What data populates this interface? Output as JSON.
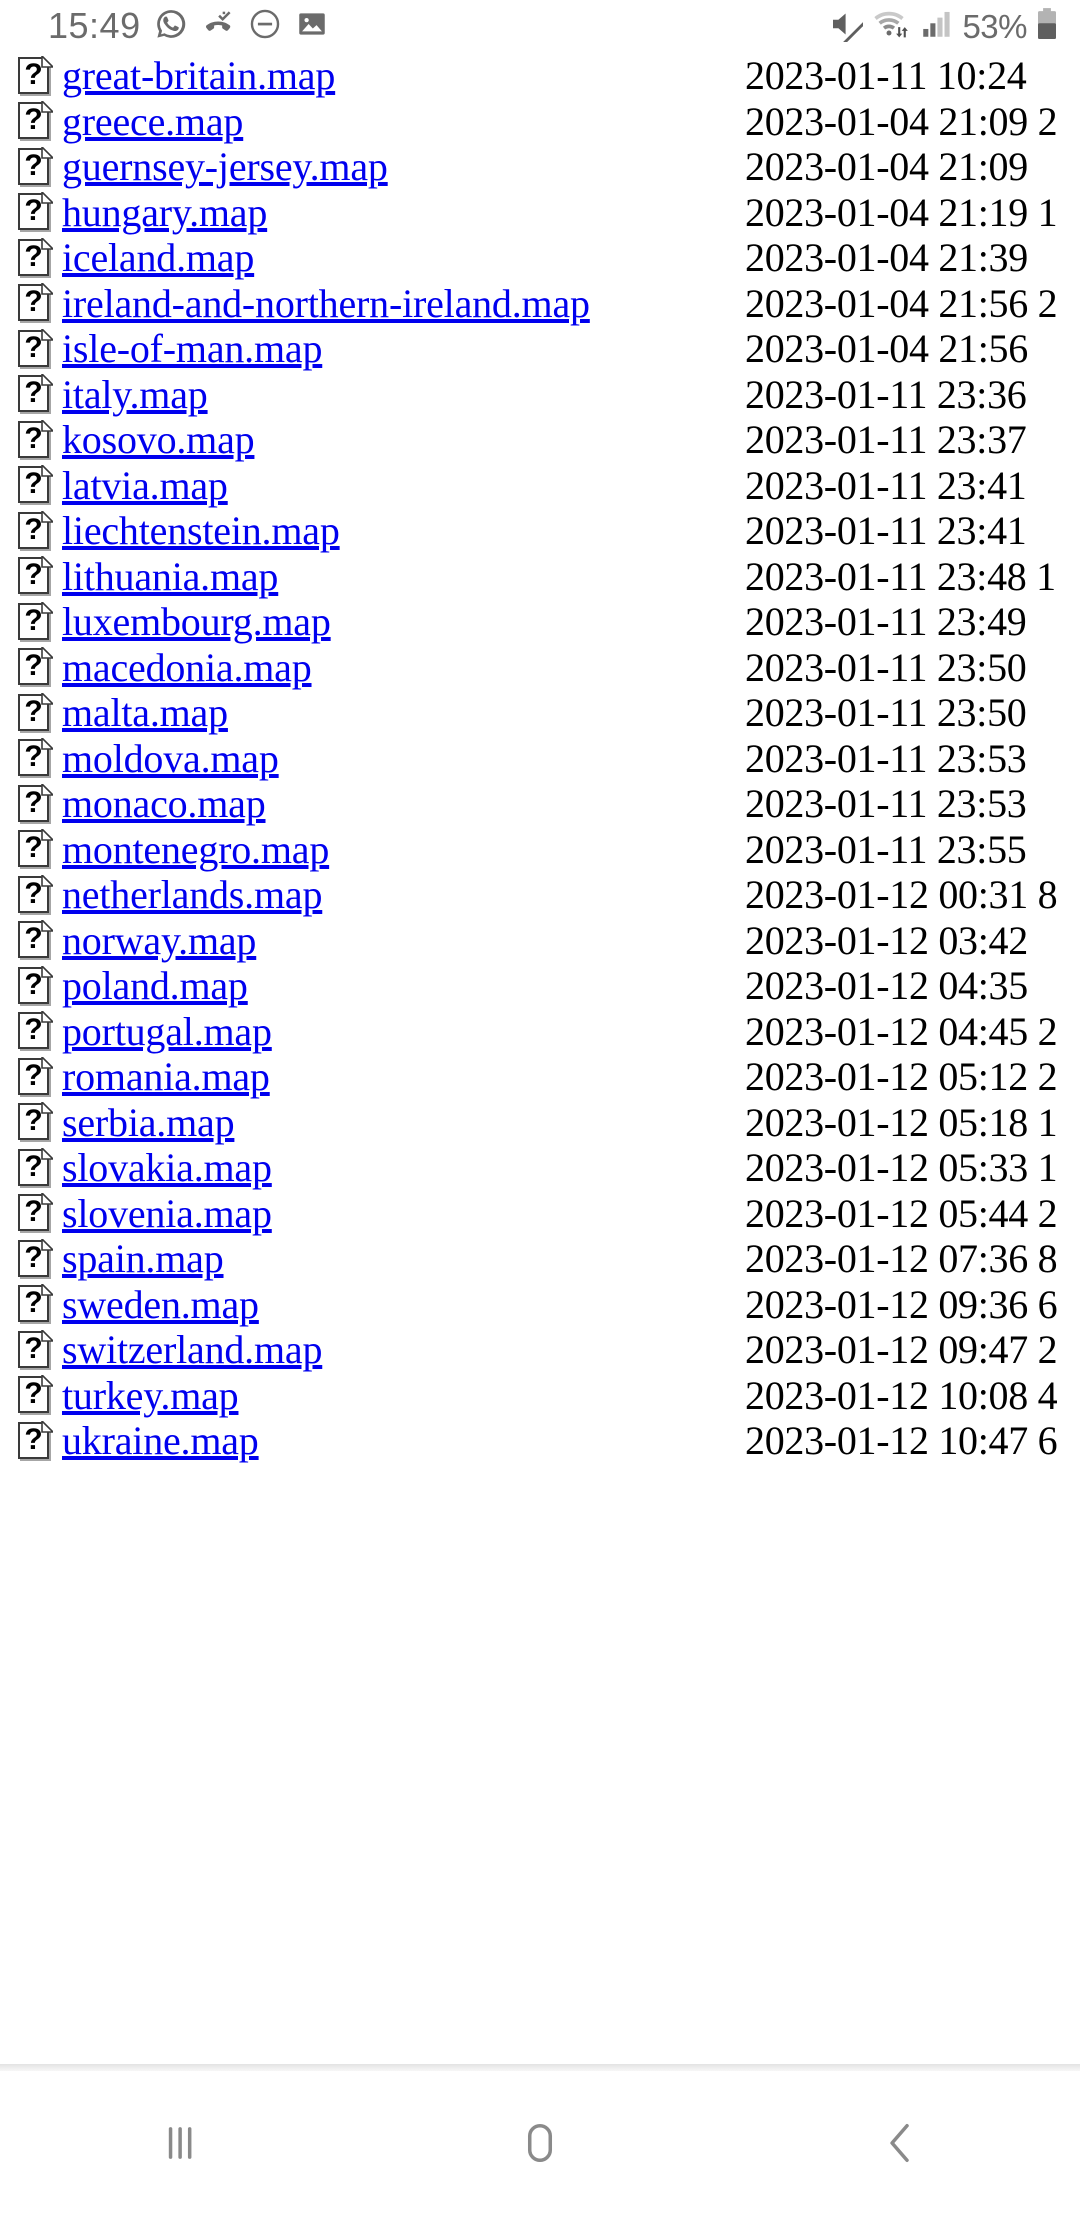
{
  "status_bar": {
    "time": "15:49",
    "battery_percent": "53%",
    "left_icons": [
      {
        "name": "whatsapp-icon"
      },
      {
        "name": "missed-call-icon"
      },
      {
        "name": "do-not-disturb-icon"
      },
      {
        "name": "screenshot-image-icon"
      }
    ],
    "right_icons": [
      {
        "name": "volume-mute-icon"
      },
      {
        "name": "wifi-data-transfer-icon"
      },
      {
        "name": "cellular-signal-icon"
      },
      {
        "name": "battery-icon"
      }
    ],
    "colors": {
      "icon_gray": "#6b6b6b",
      "signal_dim": "#c9c9c9"
    }
  },
  "directory_listing": {
    "link_color": "#0000ee",
    "text_color": "#000000",
    "rows": [
      {
        "icon": "unknown-file-icon",
        "name": "great-britain.map",
        "meta": "2023-01-11 10:24"
      },
      {
        "icon": "unknown-file-icon",
        "name": "greece.map",
        "meta": "2023-01-04 21:09 2"
      },
      {
        "icon": "unknown-file-icon",
        "name": "guernsey-jersey.map",
        "meta": "2023-01-04 21:09"
      },
      {
        "icon": "unknown-file-icon",
        "name": "hungary.map",
        "meta": "2023-01-04 21:19 1"
      },
      {
        "icon": "unknown-file-icon",
        "name": "iceland.map",
        "meta": "2023-01-04 21:39"
      },
      {
        "icon": "unknown-file-icon",
        "name": "ireland-and-northern-ireland.map",
        "meta": "2023-01-04 21:56 2"
      },
      {
        "icon": "unknown-file-icon",
        "name": "isle-of-man.map",
        "meta": "2023-01-04 21:56"
      },
      {
        "icon": "unknown-file-icon",
        "name": "italy.map",
        "meta": "2023-01-11 23:36"
      },
      {
        "icon": "unknown-file-icon",
        "name": "kosovo.map",
        "meta": "2023-01-11 23:37"
      },
      {
        "icon": "unknown-file-icon",
        "name": "latvia.map",
        "meta": "2023-01-11 23:41"
      },
      {
        "icon": "unknown-file-icon",
        "name": "liechtenstein.map",
        "meta": "2023-01-11 23:41"
      },
      {
        "icon": "unknown-file-icon",
        "name": "lithuania.map",
        "meta": "2023-01-11 23:48 1"
      },
      {
        "icon": "unknown-file-icon",
        "name": "luxembourg.map",
        "meta": "2023-01-11 23:49"
      },
      {
        "icon": "unknown-file-icon",
        "name": "macedonia.map",
        "meta": "2023-01-11 23:50"
      },
      {
        "icon": "unknown-file-icon",
        "name": "malta.map",
        "meta": "2023-01-11 23:50"
      },
      {
        "icon": "unknown-file-icon",
        "name": "moldova.map",
        "meta": "2023-01-11 23:53"
      },
      {
        "icon": "unknown-file-icon",
        "name": "monaco.map",
        "meta": "2023-01-11 23:53"
      },
      {
        "icon": "unknown-file-icon",
        "name": "montenegro.map",
        "meta": "2023-01-11 23:55"
      },
      {
        "icon": "unknown-file-icon",
        "name": "netherlands.map",
        "meta": "2023-01-12 00:31 8"
      },
      {
        "icon": "unknown-file-icon",
        "name": "norway.map",
        "meta": "2023-01-12 03:42"
      },
      {
        "icon": "unknown-file-icon",
        "name": "poland.map",
        "meta": "2023-01-12 04:35"
      },
      {
        "icon": "unknown-file-icon",
        "name": "portugal.map",
        "meta": "2023-01-12 04:45 2"
      },
      {
        "icon": "unknown-file-icon",
        "name": "romania.map",
        "meta": "2023-01-12 05:12 2"
      },
      {
        "icon": "unknown-file-icon",
        "name": "serbia.map",
        "meta": "2023-01-12 05:18 1"
      },
      {
        "icon": "unknown-file-icon",
        "name": "slovakia.map",
        "meta": "2023-01-12 05:33 1"
      },
      {
        "icon": "unknown-file-icon",
        "name": "slovenia.map",
        "meta": "2023-01-12 05:44 2"
      },
      {
        "icon": "unknown-file-icon",
        "name": "spain.map",
        "meta": "2023-01-12 07:36 8"
      },
      {
        "icon": "unknown-file-icon",
        "name": "sweden.map",
        "meta": "2023-01-12 09:36 6"
      },
      {
        "icon": "unknown-file-icon",
        "name": "switzerland.map",
        "meta": "2023-01-12 09:47 2"
      },
      {
        "icon": "unknown-file-icon",
        "name": "turkey.map",
        "meta": "2023-01-12 10:08 4"
      },
      {
        "icon": "unknown-file-icon",
        "name": "ukraine.map",
        "meta": "2023-01-12 10:47 6"
      }
    ]
  },
  "navigation_bar": {
    "buttons": [
      {
        "name": "recents-button",
        "icon": "recents-icon"
      },
      {
        "name": "home-button",
        "icon": "home-icon"
      },
      {
        "name": "back-button",
        "icon": "back-chevron-icon"
      }
    ],
    "icon_color": "#8a8a8a"
  }
}
